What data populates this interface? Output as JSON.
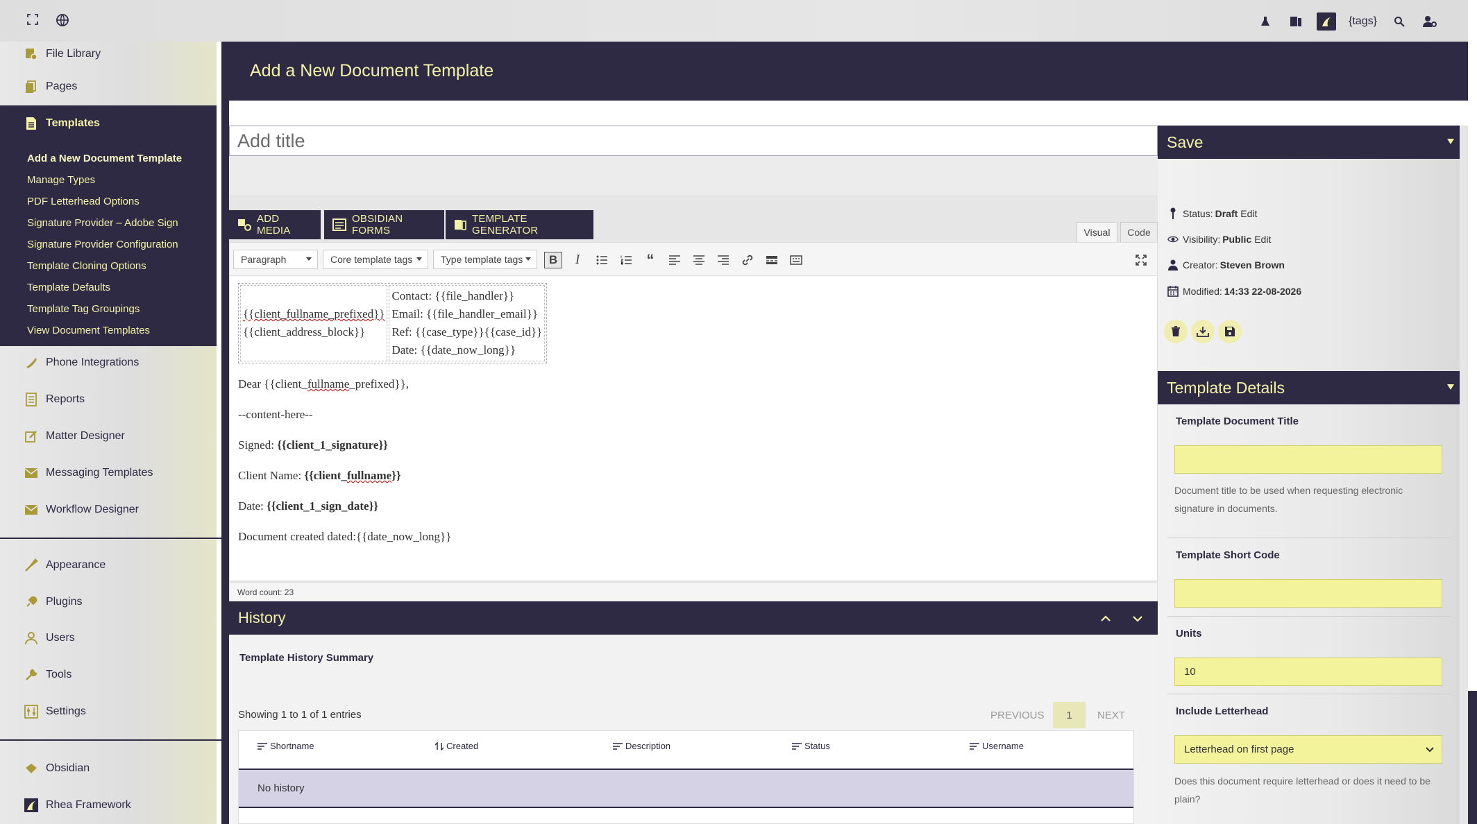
{
  "topbar": {
    "fullscreen_icon": "expand-icon",
    "globe_icon": "globe-icon",
    "tags_text": "{tags}"
  },
  "sidebar": {
    "items_top": [
      {
        "label": "File Library",
        "icon": "file-library-icon"
      },
      {
        "label": "Pages",
        "icon": "pages-icon"
      },
      {
        "label": "Templates",
        "icon": "templates-icon"
      }
    ],
    "submenu": [
      "Add a New Document Template",
      "Manage Types",
      "PDF Letterhead Options",
      "Signature Provider – Adobe Sign",
      "Signature Provider Configuration",
      "Template Cloning Options",
      "Template Defaults",
      "Template Tag Groupings",
      "View Document Templates"
    ],
    "items_mid": [
      {
        "label": "Phone Integrations",
        "icon": "phone-icon"
      },
      {
        "label": "Reports",
        "icon": "reports-icon"
      },
      {
        "label": "Matter Designer",
        "icon": "edit-icon"
      },
      {
        "label": "Messaging Templates",
        "icon": "mail-icon"
      },
      {
        "label": "Workflow Designer",
        "icon": "mail-icon"
      }
    ],
    "items_admin": [
      {
        "label": "Appearance",
        "icon": "brush-icon"
      },
      {
        "label": "Plugins",
        "icon": "plug-icon"
      },
      {
        "label": "Users",
        "icon": "user-icon"
      },
      {
        "label": "Tools",
        "icon": "wrench-icon"
      },
      {
        "label": "Settings",
        "icon": "settings-icon"
      }
    ],
    "items_bottom": [
      {
        "label": "Obsidian",
        "icon": "obsidian-icon"
      },
      {
        "label": "Rhea Framework",
        "icon": "rhea-icon"
      }
    ]
  },
  "page": {
    "heading": "Add a New Document Template",
    "title_placeholder": "Add title"
  },
  "media_buttons": {
    "add_media": "ADD MEDIA",
    "obsidian_forms": "OBSIDIAN FORMS",
    "template_generator": "TEMPLATE GENERATOR"
  },
  "editor_tabs": {
    "visual": "Visual",
    "code": "Code"
  },
  "toolbar": {
    "format": "Paragraph",
    "core_tags": "Core template tags",
    "type_tags": "Type template tags"
  },
  "content": {
    "addr_line1": "{{client_fullname_prefixed}}",
    "addr_line2": "{{client_address_block}}",
    "contact": "Contact: {{file_handler}}",
    "email": "Email: {{file_handler_email}}",
    "ref": "Ref: {{case_type}}{{case_id}}",
    "date": "Date: {{date_now_long}}",
    "dear_a": "Dear {{client_",
    "dear_b": "fullname",
    "dear_c": "_prefixed}},",
    "content_here": "--content-here--",
    "signed_label": "Signed: ",
    "signed_value": "{{client_1_signature}}",
    "client_label": "Client Name: ",
    "client_value_a": "{{client_",
    "client_value_b": "fullname",
    "client_value_c": "}}",
    "date_label": "Date: ",
    "date_value": "{{client_1_sign_date}}",
    "created": "Document created dated:{{date_now_long}}"
  },
  "word_count": "Word count: 23",
  "history": {
    "title": "History",
    "subtitle": "Template History Summary",
    "showing": "Showing 1 to 1 of 1 entries",
    "previous": "PREVIOUS",
    "page": "1",
    "next": "NEXT",
    "columns": [
      "Shortname",
      "Created",
      "Description",
      "Status",
      "Username"
    ],
    "empty": "No history"
  },
  "save_panel": {
    "title": "Save",
    "status_label": "Status:",
    "status_value": "Draft",
    "status_edit": "Edit",
    "visibility_label": "Visibility:",
    "visibility_value": "Public",
    "visibility_edit": "Edit",
    "creator_label": "Creator:",
    "creator_value": "Steven Brown",
    "modified_label": "Modified:",
    "modified_value": "14:33 22-08-2026"
  },
  "details_panel": {
    "title": "Template Details",
    "doc_title_label": "Template Document Title",
    "doc_title_value": "",
    "doc_title_help": "Document title to be used when requesting electronic signature in documents.",
    "short_code_label": "Template Short Code",
    "short_code_value": "",
    "units_label": "Units",
    "units_value": "10",
    "letterhead_label": "Include Letterhead",
    "letterhead_value": "Letterhead on first page",
    "letterhead_help": "Does this document require letterhead or does it need to be plain?"
  },
  "colors": {
    "brand_dark": "#2e2a44",
    "brand_yellow": "#f4f2a8",
    "field_yellow": "#f2f39a"
  }
}
